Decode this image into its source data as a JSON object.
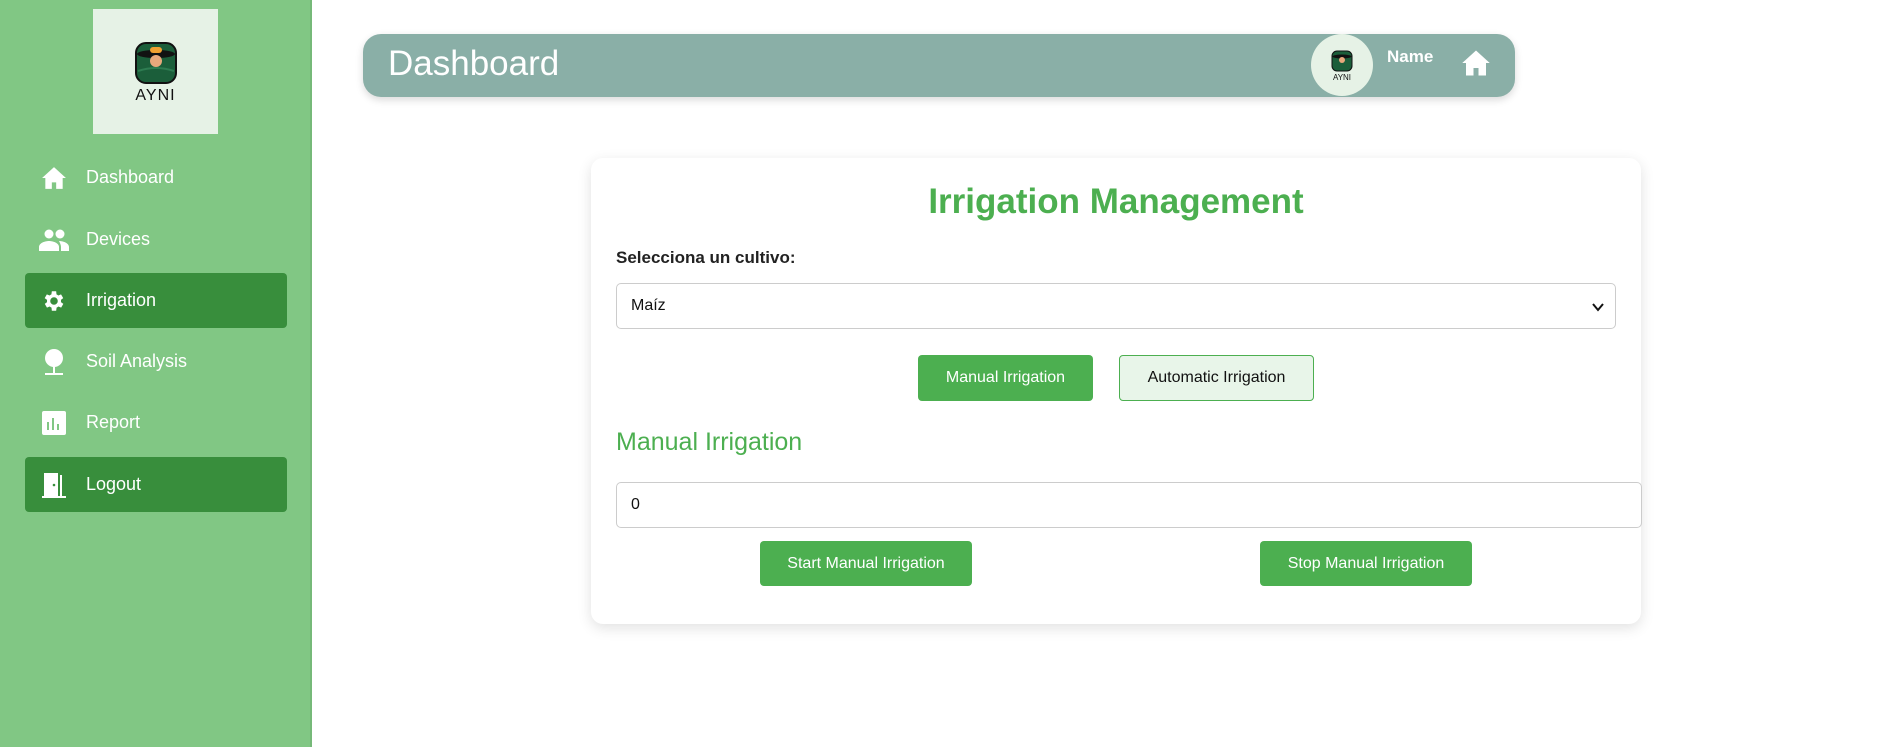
{
  "sidebar": {
    "logo_text": "AYNI",
    "items": [
      {
        "label": "Dashboard",
        "icon": "home-icon",
        "active": false
      },
      {
        "label": "Devices",
        "icon": "people-icon",
        "active": false
      },
      {
        "label": "Irrigation",
        "icon": "gear-icon",
        "active": true
      },
      {
        "label": "Soil Analysis",
        "icon": "tree-icon",
        "active": false
      },
      {
        "label": "Report",
        "icon": "bar-chart-icon",
        "active": false
      },
      {
        "label": "Logout",
        "icon": "door-icon",
        "active": true
      }
    ]
  },
  "header": {
    "title": "Dashboard",
    "user_name": "Name",
    "avatar_text": "AYNI"
  },
  "card": {
    "title": "Irrigation Management",
    "select_label": "Selecciona un cultivo:",
    "select_value": "Maíz",
    "mode_buttons": {
      "manual": "Manual Irrigation",
      "automatic": "Automatic Irrigation"
    },
    "section_title": "Manual Irrigation",
    "input_value": "0",
    "start_label": "Start Manual Irrigation",
    "stop_label": "Stop Manual Irrigation"
  },
  "colors": {
    "sidebar": "#81c784",
    "active": "#388e3c",
    "header": "#8aafa7",
    "accent": "#4caf50"
  }
}
